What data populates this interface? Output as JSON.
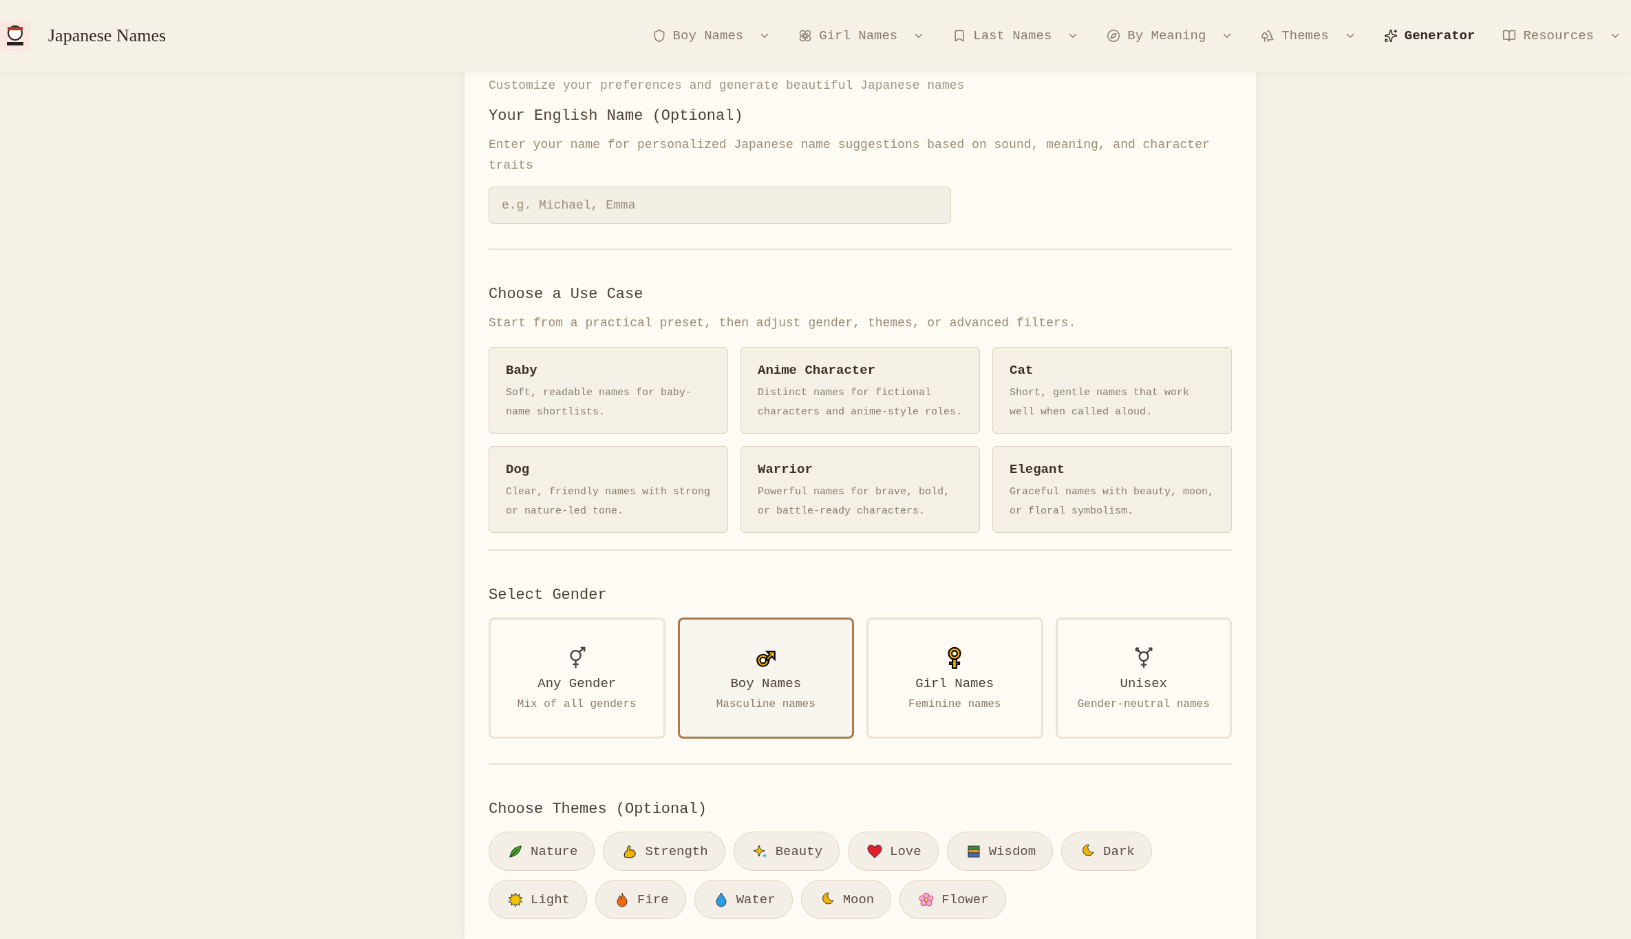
{
  "header": {
    "brand": "Japanese Names",
    "nav": [
      {
        "label": "Boy Names",
        "selected": false,
        "dropdown": true
      },
      {
        "label": "Girl Names",
        "selected": false,
        "dropdown": true
      },
      {
        "label": "Last Names",
        "selected": false,
        "dropdown": true
      },
      {
        "label": "By Meaning",
        "selected": false,
        "dropdown": true
      },
      {
        "label": "Themes",
        "selected": false,
        "dropdown": true
      },
      {
        "label": "Generator",
        "selected": true,
        "dropdown": false
      },
      {
        "label": "Resources",
        "selected": false,
        "dropdown": true
      }
    ]
  },
  "subtitle": "Customize your preferences and generate beautiful Japanese names",
  "name_section": {
    "title": "Your English Name (Optional)",
    "description": "Enter your name for personalized Japanese name suggestions based on sound, meaning, and character traits",
    "placeholder": "e.g. Michael, Emma"
  },
  "use_case": {
    "title": "Choose a Use Case",
    "description": "Start from a practical preset, then adjust gender, themes, or advanced filters.",
    "cards": [
      {
        "title": "Baby",
        "description": "Soft, readable names for baby-name shortlists."
      },
      {
        "title": "Anime Character",
        "description": "Distinct names for fictional characters and anime-style roles."
      },
      {
        "title": "Cat",
        "description": "Short, gentle names that work well when called aloud."
      },
      {
        "title": "Dog",
        "description": "Clear, friendly names with strong or nature-led tone."
      },
      {
        "title": "Warrior",
        "description": "Powerful names for brave, bold, or battle-ready characters."
      },
      {
        "title": "Elegant",
        "description": "Graceful names with beauty, moon, or floral symbolism."
      }
    ]
  },
  "gender": {
    "title": "Select Gender",
    "options": [
      {
        "label": "Any Gender",
        "description": "Mix of all genders",
        "selected": false
      },
      {
        "label": "Boy Names",
        "description": "Masculine names",
        "selected": true
      },
      {
        "label": "Girl Names",
        "description": "Feminine names",
        "selected": false
      },
      {
        "label": "Unisex",
        "description": "Gender-neutral names",
        "selected": false
      }
    ]
  },
  "themes": {
    "title": "Choose Themes (Optional)",
    "chips": [
      {
        "label": "Nature",
        "selected": false
      },
      {
        "label": "Strength",
        "selected": false
      },
      {
        "label": "Beauty",
        "selected": false
      },
      {
        "label": "Love",
        "selected": false
      },
      {
        "label": "Wisdom",
        "selected": false
      },
      {
        "label": "Dark",
        "selected": false
      },
      {
        "label": "Light",
        "selected": false
      },
      {
        "label": "Fire",
        "selected": false
      },
      {
        "label": "Water",
        "selected": false
      },
      {
        "label": "Moon",
        "selected": false
      },
      {
        "label": "Flower",
        "selected": false
      }
    ]
  }
}
